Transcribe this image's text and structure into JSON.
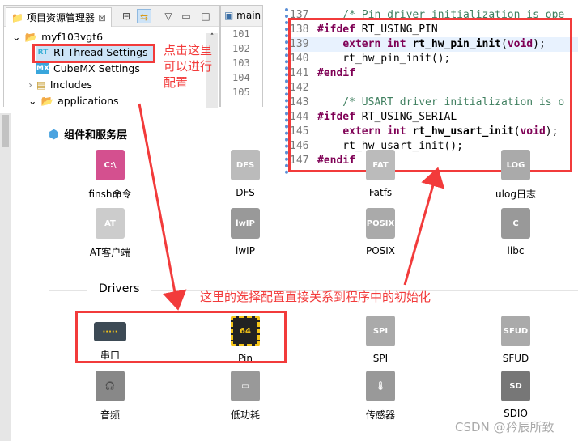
{
  "explorer": {
    "tab_title": "项目资源管理器",
    "close": "⊠",
    "project": "myf103vgt6",
    "items": [
      {
        "label": "RT-Thread Settings",
        "icon": "RT"
      },
      {
        "label": "CubeMX Settings",
        "icon": "MX"
      },
      {
        "label": "Includes"
      },
      {
        "label": "applications"
      }
    ]
  },
  "editor": {
    "tab": "main",
    "line_numbers": [
      "101",
      "102",
      "103",
      "104",
      "105"
    ]
  },
  "code": {
    "lines": [
      {
        "n": "137",
        "t": "    /* Pin driver initialization is ope"
      },
      {
        "n": "138",
        "t": "#ifdef RT_USING_PIN"
      },
      {
        "n": "139",
        "t": "    extern int rt_hw_pin_init(void);"
      },
      {
        "n": "140",
        "t": "    rt_hw_pin_init();"
      },
      {
        "n": "141",
        "t": "#endif"
      },
      {
        "n": "142",
        "t": ""
      },
      {
        "n": "143",
        "t": "    /* USART driver initialization is o"
      },
      {
        "n": "144",
        "t": "#ifdef RT_USING_SERIAL"
      },
      {
        "n": "145",
        "t": "    extern int rt_hw_usart_init(void);"
      },
      {
        "n": "146",
        "t": "    rt_hw_usart_init();"
      },
      {
        "n": "147",
        "t": "#endif"
      }
    ]
  },
  "annotations": {
    "click_here": "点击这里可以进行配置",
    "relation": "这里的选择配置直接关系到程序中的初始化",
    "color": "#f23b3b"
  },
  "components": {
    "title": "组件和服务层",
    "items": [
      {
        "label": "finsh命令",
        "icon": "C:\\"
      },
      {
        "label": "DFS",
        "icon": "DFS"
      },
      {
        "label": "Fatfs",
        "icon": "FAT"
      },
      {
        "label": "ulog日志",
        "icon": "LOG"
      },
      {
        "label": "AT客户端",
        "icon": "AT"
      },
      {
        "label": "lwIP",
        "icon": "lwIP"
      },
      {
        "label": "POSIX",
        "icon": "POSIX"
      },
      {
        "label": "libc",
        "icon": "C"
      }
    ]
  },
  "drivers": {
    "title": "Drivers",
    "items": [
      {
        "label": "串口",
        "icon": "·····"
      },
      {
        "label": "Pin",
        "icon": "64"
      },
      {
        "label": "SPI",
        "icon": "SPI"
      },
      {
        "label": "SFUD",
        "icon": "SFUD"
      },
      {
        "label": "音频",
        "icon": "🎧"
      },
      {
        "label": "低功耗",
        "icon": "▭"
      },
      {
        "label": "传感器",
        "icon": "🌡"
      },
      {
        "label": "SDIO",
        "icon": "SD"
      }
    ]
  },
  "watermark": "CSDN @矜辰所致"
}
